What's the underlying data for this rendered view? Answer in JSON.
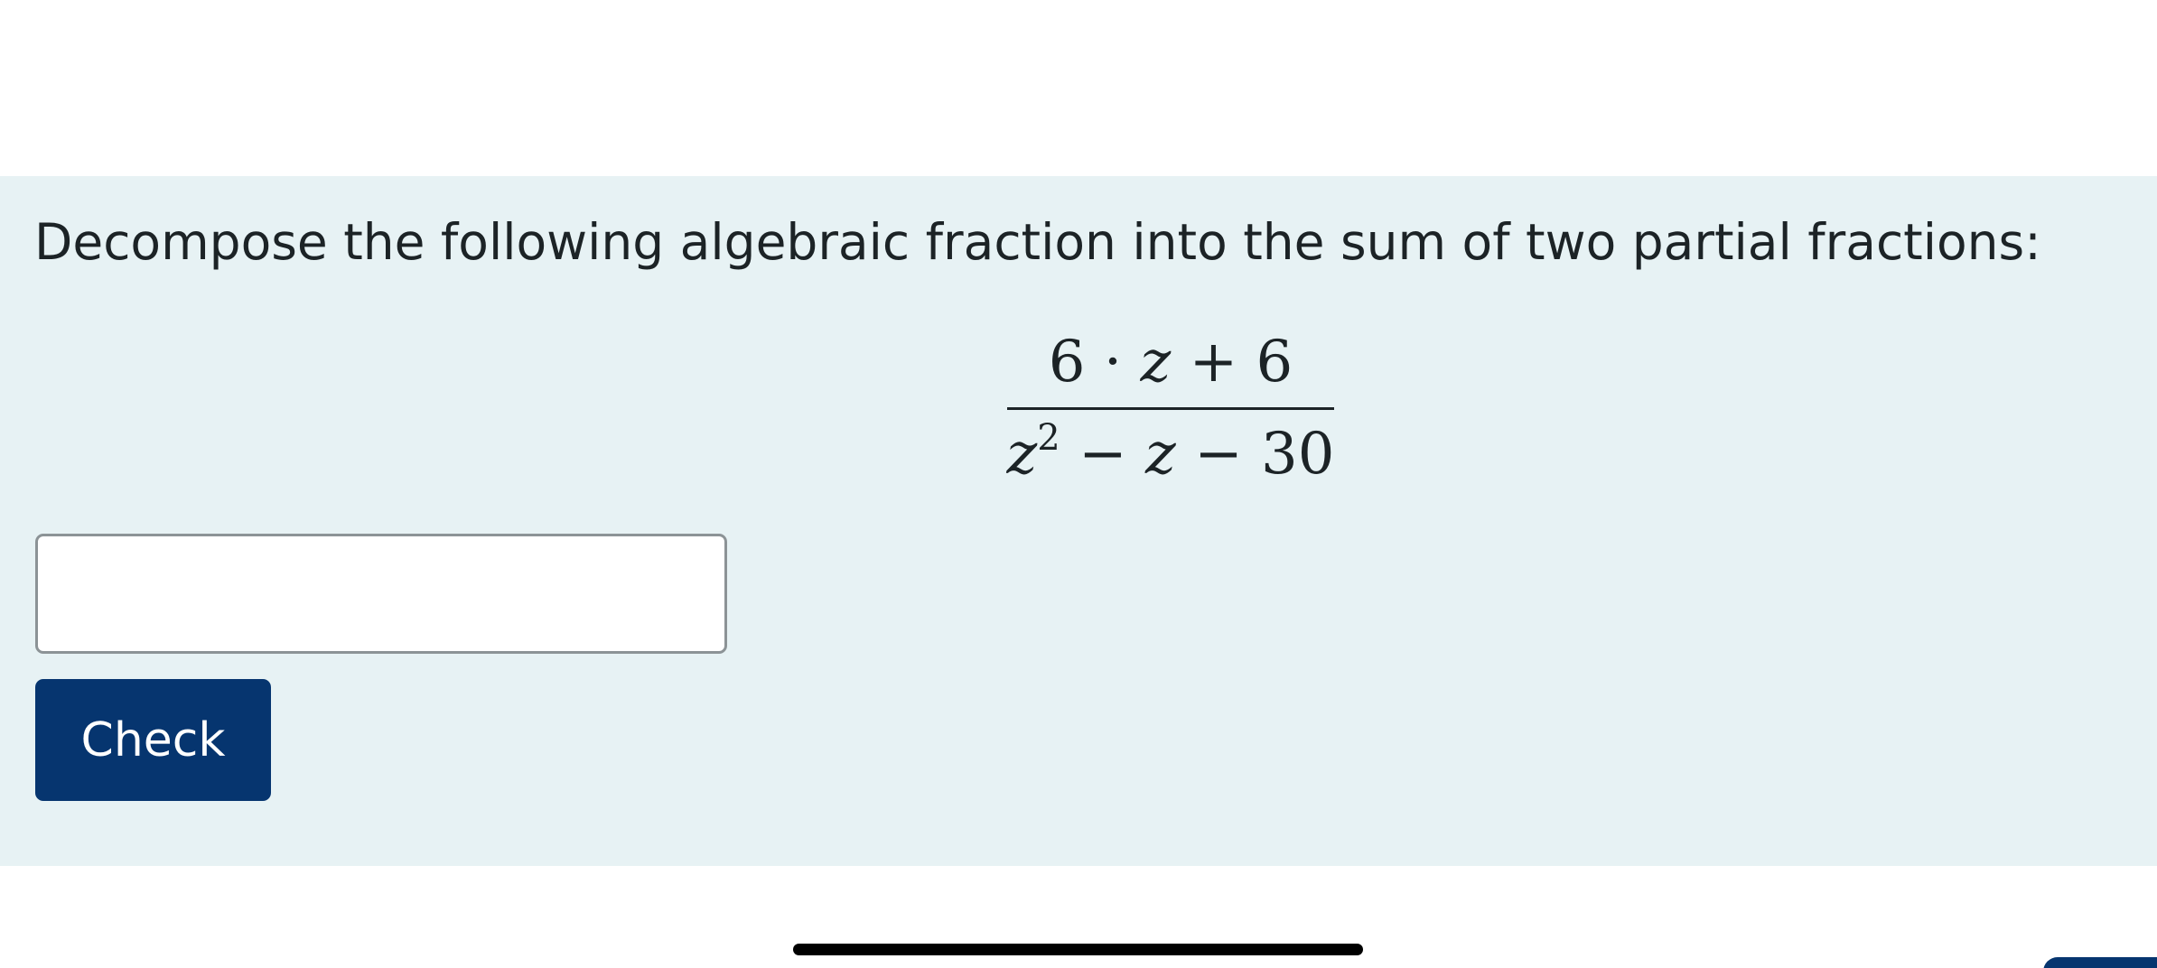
{
  "question": {
    "prompt": "Decompose the following algebraic fraction into the sum of two partial fractions:",
    "fraction": {
      "numerator": {
        "coef": "6",
        "dot": "·",
        "var": "z",
        "op": "+",
        "const": "6"
      },
      "denominator": {
        "var": "z",
        "exp": "2",
        "op1": "−",
        "var2": "z",
        "op2": "−",
        "const": "30"
      }
    }
  },
  "answer": {
    "value": "",
    "placeholder": ""
  },
  "check_button": {
    "label": "Check"
  },
  "colors": {
    "panel_background": "#e7f2f4",
    "button_background": "#06356f",
    "text": "#1c2326"
  }
}
